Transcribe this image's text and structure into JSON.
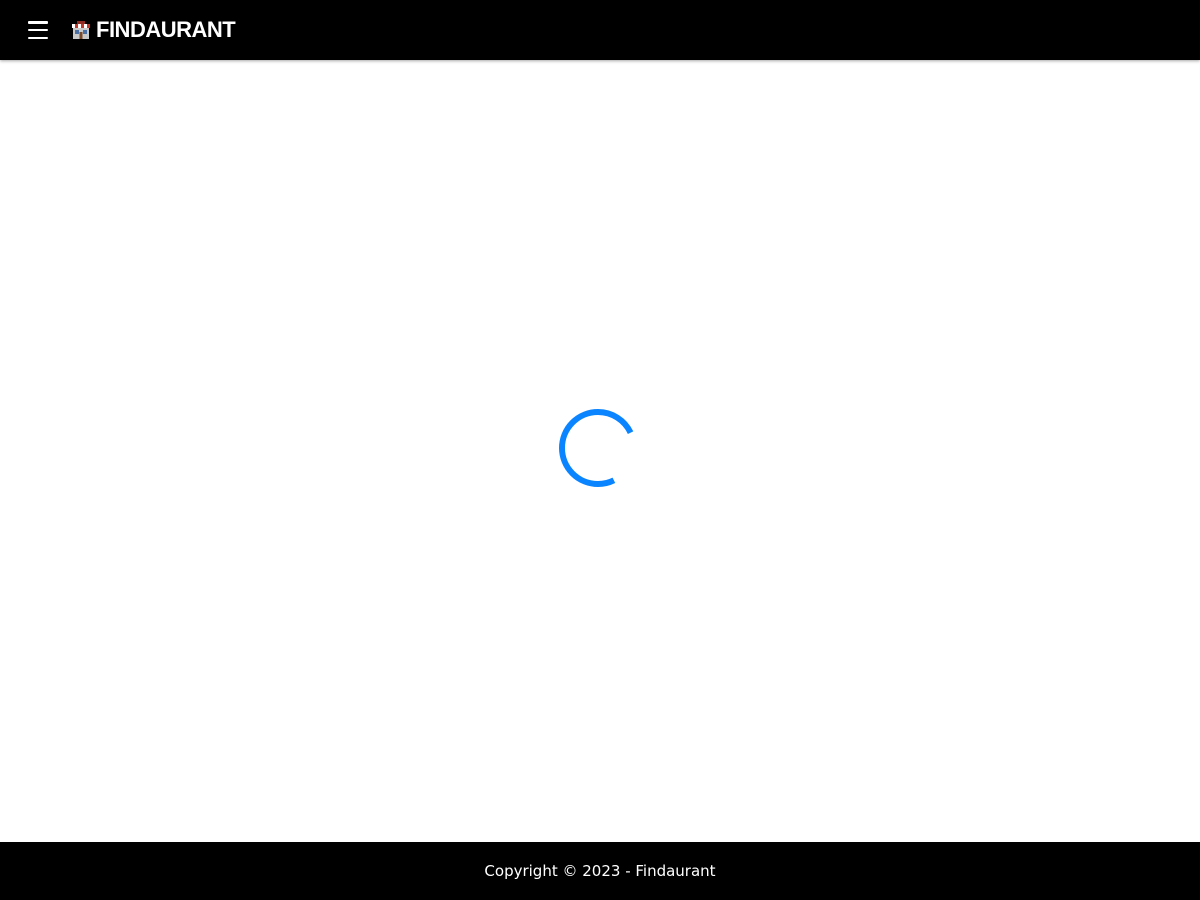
{
  "navbar": {
    "brand_icon": "restaurant-building-icon",
    "brand_name": "FINDAURANT",
    "menu_icon": "hamburger-menu-icon"
  },
  "main": {
    "loading_indicator": "loading-spinner-icon",
    "accent_color": "#0a84ff"
  },
  "footer": {
    "copyright": "Copyright © 2023 - Findaurant"
  },
  "colors": {
    "header_bg": "#000000",
    "footer_bg": "#000000",
    "page_bg": "#ffffff",
    "spinner": "#0a84ff"
  }
}
